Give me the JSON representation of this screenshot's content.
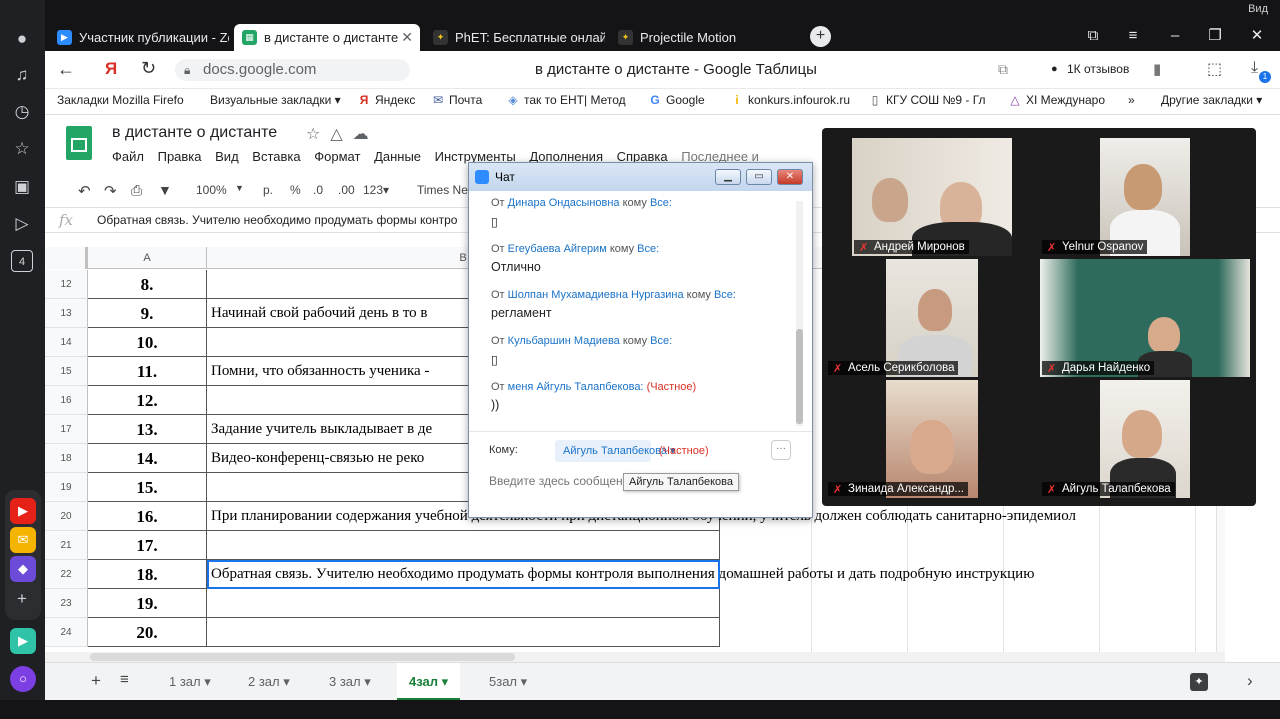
{
  "browser": {
    "corner_label": "Вид",
    "tabs": [
      {
        "label": "Участник публикации - Zo",
        "favicon": "zoom-icon",
        "active": false
      },
      {
        "label": "в дистанте о дистанте",
        "favicon": "sheets-icon",
        "active": true
      },
      {
        "label": "PhET: Бесплатные онлайн",
        "favicon": "phet-icon",
        "active": false
      },
      {
        "label": "Projectile Motion",
        "favicon": "phet-icon",
        "active": false
      }
    ],
    "new_tab": "+",
    "address": "docs.google.com",
    "page_title": "в дистанте о дистанте - Google Таблицы",
    "reviews": "1К отзывов",
    "badge_count": "1",
    "bookmarks": [
      "Закладки Mozilla Firefo",
      "Визуальные закладки ▾",
      "Яндекс",
      "Почта",
      "так то ЕНТ| Метод",
      "Google",
      "konkurs.infourok.ru",
      "КГУ СОШ №9 - Гл",
      "XI Междунаро",
      "»",
      "Другие закладки ▾"
    ]
  },
  "sheet": {
    "title": "в дистанте о дистанте",
    "menu": [
      "Файл",
      "Правка",
      "Вид",
      "Вставка",
      "Формат",
      "Данные",
      "Инструменты",
      "Дополнения",
      "Справка",
      "Последнее и"
    ],
    "toolbar": {
      "zoom": "100%",
      "currency": "р.",
      "percent": "%",
      "dec_less": ".0",
      "dec_more": ".00",
      "format": "123▾",
      "font": "Times New"
    },
    "formula_icon": "fx",
    "formula_text": "Обратная связь.  Учителю необходимо продумать формы контро",
    "col_a": "A",
    "col_b": "B",
    "rows": [
      {
        "n": "12",
        "a": "8.",
        "b": ""
      },
      {
        "n": "13",
        "a": "9.",
        "b": "Начинай свой рабочий день в то в"
      },
      {
        "n": "14",
        "a": "10.",
        "b": ""
      },
      {
        "n": "15",
        "a": "11.",
        "b": "Помни, что обязанность ученика -"
      },
      {
        "n": "16",
        "a": "12.",
        "b": ""
      },
      {
        "n": "17",
        "a": "13.",
        "b": "Задание учитель выкладывает в де"
      },
      {
        "n": "18",
        "a": "14.",
        "b": "Видео-конференц-связью   не реко"
      },
      {
        "n": "19",
        "a": "15.",
        "b": ""
      },
      {
        "n": "20",
        "a": "16.",
        "b": "При планировании содержания учебной деятельности при дистанционном обучении, учитель должен соблюдать санитарно-эпидемиол"
      },
      {
        "n": "21",
        "a": "17.",
        "b": ""
      },
      {
        "n": "22",
        "a": "18.",
        "b": "Обратная связь.  Учителю необходимо продумать формы контроля выполнения домашней работы и дать подробную инструкцию"
      },
      {
        "n": "23",
        "a": "19.",
        "b": ""
      },
      {
        "n": "24",
        "a": "20.",
        "b": ""
      }
    ],
    "sheet_tabs": [
      {
        "label": "1 зал ▾",
        "active": false
      },
      {
        "label": "2 зал ▾",
        "active": false
      },
      {
        "label": "3 зал ▾",
        "active": false
      },
      {
        "label": "4зал ▾",
        "active": true
      },
      {
        "label": "5зал ▾",
        "active": false
      }
    ]
  },
  "chat": {
    "title": "Чат",
    "messages": [
      {
        "from_prefix": "От",
        "from": "Динара Ондасыновна",
        "to_prefix": "кому",
        "to": "Все:",
        "private": "",
        "body": "▯"
      },
      {
        "from_prefix": "От",
        "from": "Егеубаева Айгерим",
        "to_prefix": "кому",
        "to": "Все:",
        "private": "",
        "body": "Отлично"
      },
      {
        "from_prefix": "От",
        "from": "Шолпан Мухамадиевна Нургазина",
        "to_prefix": "кому",
        "to": "Все:",
        "private": "",
        "body": "регламент"
      },
      {
        "from_prefix": "От",
        "from": "Кульбаршин Мадиева",
        "to_prefix": "кому",
        "to": "Все:",
        "private": "",
        "body": "▯"
      },
      {
        "from_prefix": "От",
        "from": "меня",
        "to_prefix": "",
        "to": "Айгуль Талапбекова:",
        "private": "(Частное)",
        "body": "))"
      }
    ],
    "to_label": "Кому:",
    "to_value": "Айгуль Талапбекова ▾",
    "to_private": "(Частное)",
    "more": "···",
    "input_placeholder": "Введите здесь сообщение",
    "tooltip": "Айгуль Талапбекова"
  },
  "video": {
    "participants": [
      {
        "name": "Андрей Миронов"
      },
      {
        "name": "Yelnur Ospanov"
      },
      {
        "name": "Асель Серикболова"
      },
      {
        "name": "Дарья Найденко"
      },
      {
        "name": "Зинаида Александр..."
      },
      {
        "name": "Айгуль Талапбекова"
      }
    ]
  },
  "colors": {
    "sheets_green": "#188038",
    "chat_link": "#1a73c8",
    "private_red": "#d93025",
    "zoom_blue": "#2d8cff"
  }
}
